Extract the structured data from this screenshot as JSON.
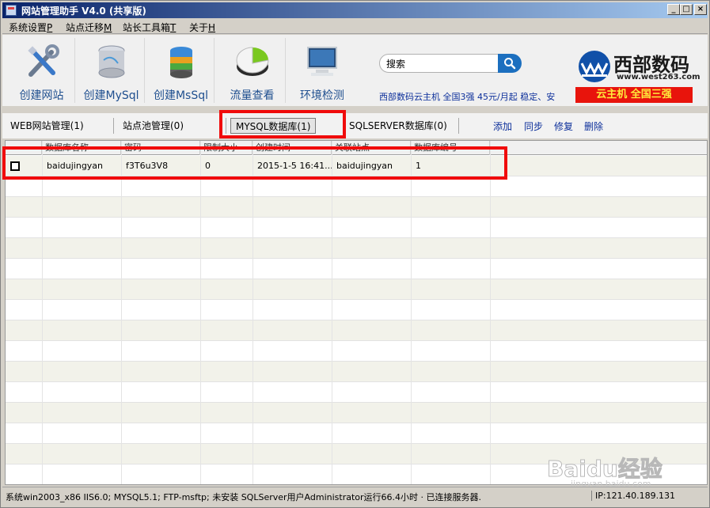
{
  "window": {
    "title": "网站管理助手 V4.0 (共享版)",
    "min_label": "_",
    "max_label": "□",
    "close_label": "×"
  },
  "menu": [
    {
      "label": "系统设置",
      "key": "P"
    },
    {
      "label": "站点迁移",
      "key": "M"
    },
    {
      "label": "站长工具箱",
      "key": "T"
    },
    {
      "label": "关于",
      "key": "H"
    }
  ],
  "toolbar": {
    "buttons": [
      {
        "label": "创建网站",
        "icon": "tools-icon"
      },
      {
        "label": "创建MySql",
        "icon": "mysql-database-icon"
      },
      {
        "label": "创建MsSql",
        "icon": "mssql-database-icon"
      },
      {
        "label": "流量查看",
        "icon": "pie-chart-icon"
      },
      {
        "label": "环境检测",
        "icon": "monitor-icon"
      }
    ],
    "search": {
      "value": "搜索",
      "icon": "search-icon"
    }
  },
  "brand": {
    "name": "西部数码",
    "url": "www.west263.com",
    "ad_text": "西部数码云主机  全国3强  45元/月起  稳定、安",
    "banner": "云主机  全国三强",
    "banner_color": "#e8140c"
  },
  "tabs": [
    {
      "label": "WEB网站管理(1)",
      "active": false
    },
    {
      "label": "站点池管理(0)",
      "active": false
    },
    {
      "label": "MYSQL数据库(1)",
      "active": true
    },
    {
      "label": "SQLSERVER数据库(0)",
      "active": false
    }
  ],
  "actions": [
    "添加",
    "同步",
    "修复",
    "删除"
  ],
  "grid": {
    "columns": [
      "",
      "数据库名称",
      "密码",
      "限制大小",
      "创建时间",
      "关联站点",
      "数据库编号"
    ],
    "rows": [
      [
        "",
        "baidujingyan",
        "f3T6u3V8",
        "0",
        "2015-1-5 16:41...",
        "baidujingyan",
        "1"
      ]
    ]
  },
  "status": {
    "main": "系统win2003_x86 IIS6.0; MYSQL5.1; FTP-msftp; 未安装 SQLServer用户Administrator运行66.4小时 · 已连接服务器.",
    "ip": "IP:121.40.189.131"
  },
  "watermark": {
    "text": "Baidu经验",
    "sub": "jingyan.baidu.com"
  },
  "highlight_color": "#f00b0b"
}
